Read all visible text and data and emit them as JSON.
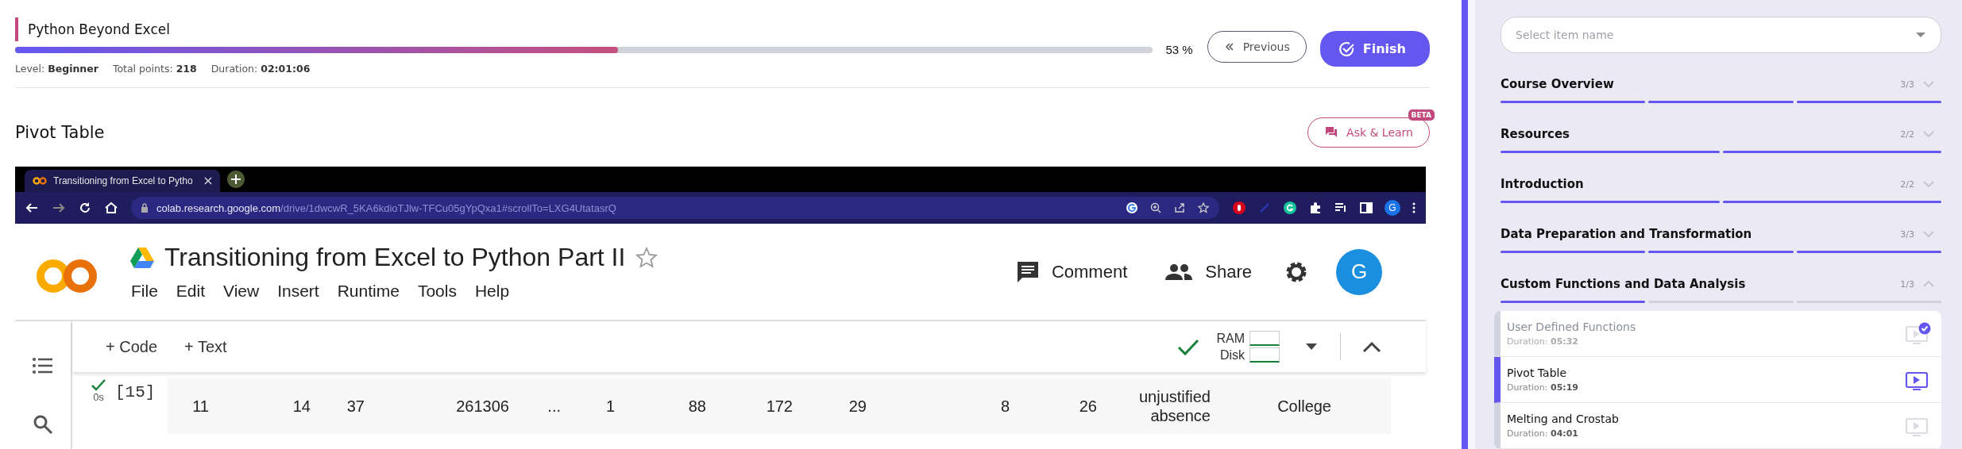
{
  "course": {
    "title": "Python Beyond Excel",
    "progress": {
      "level": 0.53,
      "label": "53 %"
    },
    "meta": [
      {
        "label": "Level:",
        "value": "Beginner"
      },
      {
        "label": "Total points:",
        "value": "218"
      },
      {
        "label": "Duration:",
        "value": "02:01:06"
      }
    ],
    "previous": "Previous",
    "finish": "Finish"
  },
  "lesson": {
    "title": "Pivot Table",
    "ask_button": "Ask & Learn",
    "ask_badge": "BETA"
  },
  "video": {
    "browser": {
      "tab_title": "Transitioning from Excel to Pytho",
      "url_host": "colab.research.google.com",
      "url_path": "/drive/1dwcwR_5KA6kdioTJlw-TFCu05gYpQxa1#scrollTo=LXG4UtatasrQ",
      "profile": "G"
    },
    "notebook": {
      "title": "Transitioning from Excel to Python Part II",
      "starred": false,
      "menu": [
        "File",
        "Edit",
        "View",
        "Insert",
        "Runtime",
        "Tools",
        "Help"
      ],
      "comment": "Comment",
      "share": "Share",
      "avatar": "G",
      "toolbar": [
        "+ Code",
        "+ Text"
      ],
      "resources": [
        "RAM",
        "Disk"
      ],
      "cell": {
        "count": "[15]",
        "time": "0s",
        "values": [
          "11",
          "14",
          "37",
          "261306",
          "...",
          "1",
          "88",
          "172",
          "29",
          "8",
          "26",
          "unjustified absence",
          "College"
        ]
      }
    }
  },
  "sidebar": {
    "search": {
      "placeholder": "Select item name"
    },
    "sections": [
      {
        "title": "Course Overview",
        "count": "3/3",
        "expanded": false,
        "segments": [
          {
            "done": true
          },
          {
            "done": true
          },
          {
            "done": true
          }
        ]
      },
      {
        "title": "Resources",
        "count": "2/2",
        "expanded": false,
        "segments": [
          {
            "done": true
          },
          {
            "done": true
          }
        ]
      },
      {
        "title": "Introduction",
        "count": "2/2",
        "expanded": false,
        "segments": [
          {
            "done": true
          },
          {
            "done": true
          }
        ]
      },
      {
        "title": "Data Preparation and Transformation",
        "count": "3/3",
        "expanded": false,
        "segments": [
          {
            "done": true
          },
          {
            "done": true
          },
          {
            "done": true
          }
        ]
      },
      {
        "title": "Custom Functions and Data Analysis",
        "count": "1/3",
        "expanded": true,
        "segments": [
          {
            "done": true
          },
          {
            "done": false
          },
          {
            "done": false
          }
        ],
        "lessons": [
          {
            "title": "User Defined Functions",
            "duration_label": "Duration:",
            "duration": "05:32",
            "completed": true,
            "selected": false
          },
          {
            "title": "Pivot Table",
            "duration_label": "Duration:",
            "duration": "05:19",
            "completed": false,
            "selected": true
          },
          {
            "title": "Melting and Crostab",
            "duration_label": "Duration:",
            "duration": "04:01",
            "completed": false,
            "selected": false
          }
        ]
      }
    ]
  }
}
